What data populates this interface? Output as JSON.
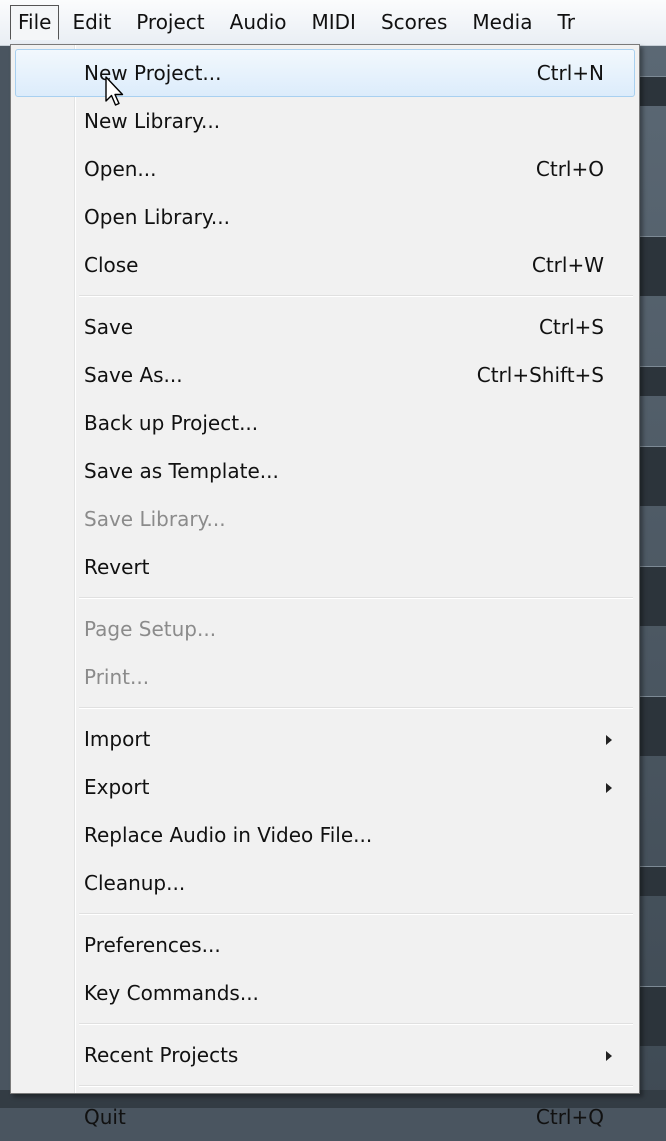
{
  "menubar": {
    "items": [
      {
        "label": "File",
        "active": true
      },
      {
        "label": "Edit"
      },
      {
        "label": "Project"
      },
      {
        "label": "Audio"
      },
      {
        "label": "MIDI"
      },
      {
        "label": "Scores"
      },
      {
        "label": "Media"
      },
      {
        "label": "Tr"
      }
    ]
  },
  "file_menu": {
    "new_project": {
      "label": "New Project...",
      "shortcut": "Ctrl+N"
    },
    "new_library": {
      "label": "New Library..."
    },
    "open": {
      "label": "Open...",
      "shortcut": "Ctrl+O"
    },
    "open_library": {
      "label": "Open Library..."
    },
    "close": {
      "label": "Close",
      "shortcut": "Ctrl+W"
    },
    "save": {
      "label": "Save",
      "shortcut": "Ctrl+S"
    },
    "save_as": {
      "label": "Save As...",
      "shortcut": "Ctrl+Shift+S"
    },
    "back_up_project": {
      "label": "Back up Project..."
    },
    "save_as_template": {
      "label": "Save as Template..."
    },
    "save_library": {
      "label": "Save Library...",
      "disabled": true
    },
    "revert": {
      "label": "Revert"
    },
    "page_setup": {
      "label": "Page Setup...",
      "disabled": true
    },
    "print": {
      "label": "Print...",
      "disabled": true
    },
    "import": {
      "label": "Import",
      "submenu": true
    },
    "export": {
      "label": "Export",
      "submenu": true
    },
    "replace_audio": {
      "label": "Replace Audio in Video File..."
    },
    "cleanup": {
      "label": "Cleanup..."
    },
    "preferences": {
      "label": "Preferences..."
    },
    "key_commands": {
      "label": "Key Commands..."
    },
    "recent_projects": {
      "label": "Recent Projects",
      "submenu": true
    },
    "quit": {
      "label": "Quit",
      "shortcut": "Ctrl+Q"
    }
  },
  "colors": {
    "highlight_border": "#a8d0f0",
    "menu_background": "#f1f1f1",
    "disabled_text": "#8b8b8b"
  }
}
